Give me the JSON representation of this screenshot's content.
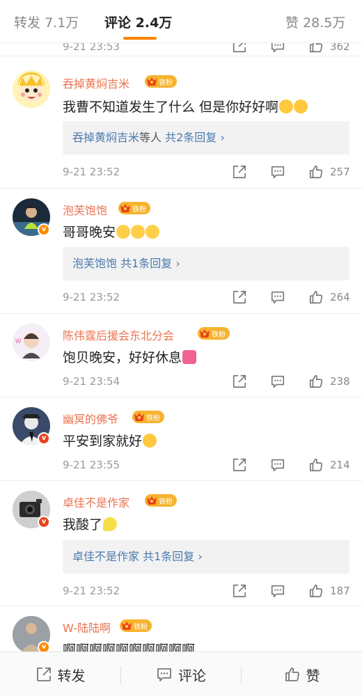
{
  "tabs": {
    "repost": {
      "label": "转发",
      "count": "7.1万"
    },
    "comment": {
      "label": "评论",
      "count": "2.4万"
    },
    "like": {
      "label": "赞",
      "count": "28.5万"
    }
  },
  "fan_badge_label": "铁粉",
  "partial_top": {
    "time": "9-21 23:53",
    "likes": "362"
  },
  "comments": [
    {
      "username": "吞掉黄焖吉米",
      "text": "我曹不知道发生了什么 但是你好好啊",
      "reply": {
        "name": "吞掉黄焖吉米",
        "middle": "等人",
        "count": "共2条回复 ›"
      },
      "time": "9-21 23:52",
      "likes": "257"
    },
    {
      "username": "泡芙饱饱",
      "text": "哥哥晚安",
      "reply": {
        "name": "泡芙饱饱",
        "middle": "",
        "count": "共1条回复 ›"
      },
      "time": "9-21 23:52",
      "likes": "264"
    },
    {
      "username": "陈伟霆后援会东北分会",
      "text": "饱贝晚安，好好休息",
      "time": "9-21 23:54",
      "likes": "238"
    },
    {
      "username": "幽冥的佛爷",
      "text": "平安到家就好",
      "time": "9-21 23:55",
      "likes": "214"
    },
    {
      "username": "卓佳不是作家",
      "text": "我酸了",
      "reply": {
        "name": "卓佳不是作家",
        "middle": "",
        "count": "共1条回复 ›"
      },
      "time": "9-21 23:52",
      "likes": "187"
    },
    {
      "username": "W-陆陆啊",
      "text": "啊啊啊啊啊啊啊啊啊啊"
    }
  ],
  "bottom": {
    "repost": "转发",
    "comment": "评论",
    "like": "赞"
  },
  "colors": {
    "accent": "#ff8200",
    "username": "#eb7350",
    "reply_link": "#4a7aae",
    "fan_badge": "#f7b32e"
  }
}
